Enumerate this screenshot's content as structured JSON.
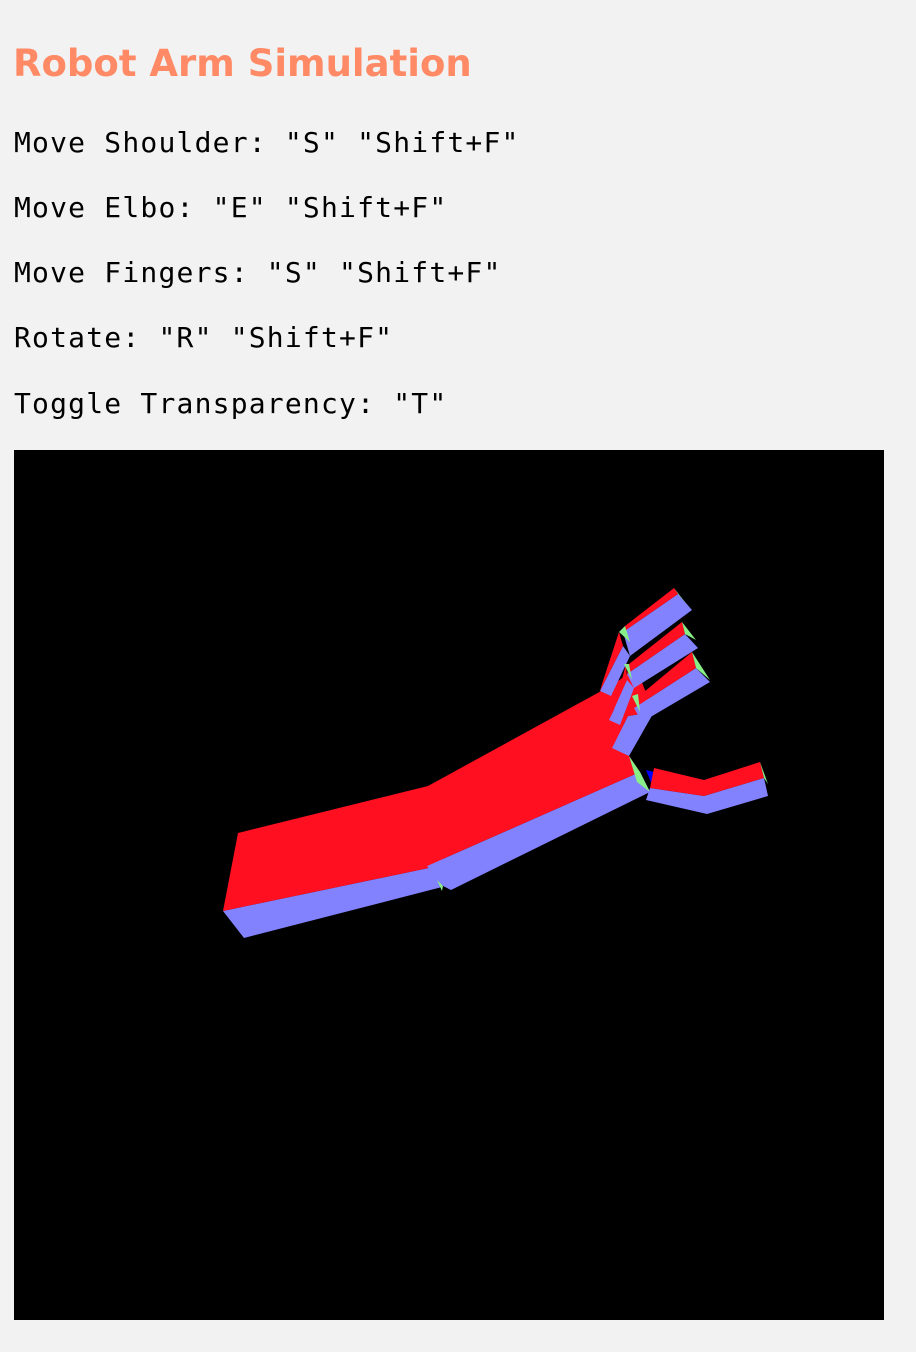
{
  "page": {
    "title": "Robot Arm Simulation",
    "title_color": "#ff8a65",
    "background_color": "#f2f2f2"
  },
  "instructions": [
    "Move Shoulder: \"S\" \"Shift+F\"",
    "Move Elbo: \"E\" \"Shift+F\"",
    "Move Fingers: \"S\" \"Shift+F\"",
    "Rotate: \"R\" \"Shift+F\"",
    "Toggle Transparency: \"T\""
  ],
  "canvas": {
    "background": "#000000",
    "face_colors": {
      "top": "#ff0f20",
      "side": "#8282ff",
      "end": "#88ee88",
      "edge": "#0000ff"
    }
  }
}
